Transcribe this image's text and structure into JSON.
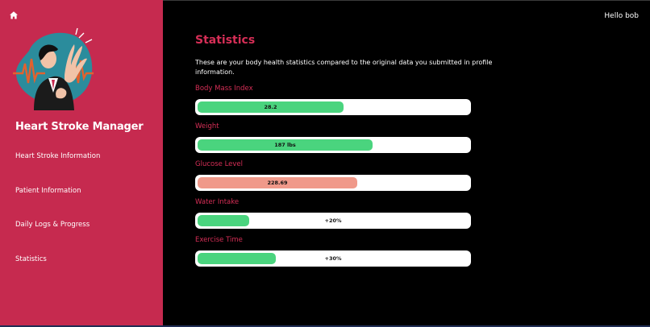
{
  "app": {
    "title": "Heart Stroke Manager",
    "greeting": "Hello bob",
    "accent": "#c62a4f",
    "heading_color": "#d52e56"
  },
  "nav": {
    "home_icon": "home-icon",
    "items": [
      {
        "label": "Heart Stroke Information"
      },
      {
        "label": "Patient Information"
      },
      {
        "label": "Daily Logs & Progress"
      },
      {
        "label": "Statistics"
      }
    ]
  },
  "main": {
    "title": "Statistics",
    "description": "These are your body health statistics compared to the original data you submitted in profile information."
  },
  "stats": [
    {
      "label": "Body Mass Index",
      "value": "28.2",
      "fill": 0.54,
      "color": "#4ad47e"
    },
    {
      "label": "Weight",
      "value": "187 lbs",
      "fill": 0.645,
      "color": "#4ad47e"
    },
    {
      "label": "Glucose Level",
      "value": "228.69",
      "fill": 0.59,
      "color": "#f0998a"
    },
    {
      "label": "Water Intake",
      "value": "+20%",
      "fill": 0.19,
      "color": "#4ad47e"
    },
    {
      "label": "Exercise Time",
      "value": "+30%",
      "fill": 0.29,
      "color": "#4ad47e"
    }
  ]
}
